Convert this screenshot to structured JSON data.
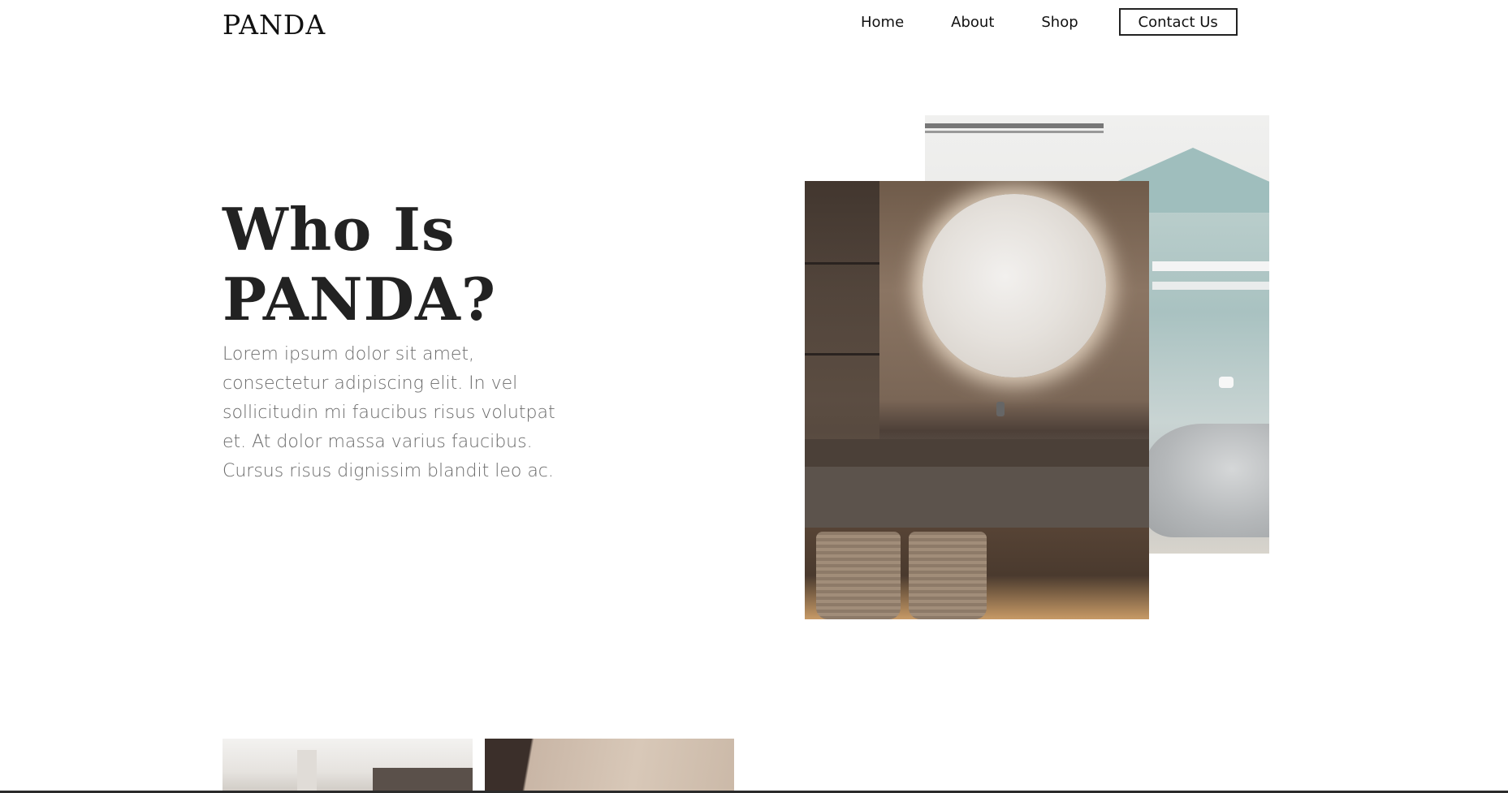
{
  "header": {
    "logo": "PANDA",
    "nav": [
      "Home",
      "About",
      "Shop"
    ],
    "contact_label": "Contact Us"
  },
  "hero": {
    "title_line1": "Who Is",
    "title_line2": "PANDA?",
    "body": "Lorem ipsum dolor sit amet, consectetur adipiscing elit. In vel sollicitudin mi faucibus risus volutpat et. At dolor massa varius faucibus. Cursus risus dignissim blandit leo ac."
  },
  "images": {
    "back": "bedroom-photo",
    "front": "bathroom-mirror-photo",
    "thumb1": "living-room-photo",
    "thumb2": "interior-photo"
  },
  "colors": {
    "text": "#222222",
    "body_text": "#6b6b6b",
    "background": "#ffffff"
  }
}
